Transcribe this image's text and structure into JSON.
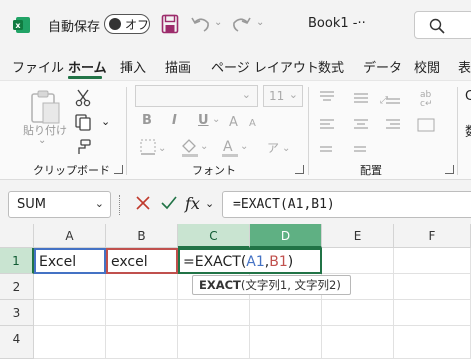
{
  "titlebar": {
    "autosave_label": "自動保存",
    "autosave_state": "オフ",
    "filename": "Book1  -··",
    "search_icon": "search-icon"
  },
  "menu": {
    "items": [
      "ファイル",
      "ホーム",
      "挿入",
      "描画",
      "ページ レイアウト",
      "数式",
      "データ",
      "校閲",
      "表"
    ],
    "active": "ホーム"
  },
  "ribbon": {
    "clipboard": {
      "paste_label": "貼り付け",
      "group_label": "クリップボード"
    },
    "font": {
      "size_value": "11",
      "bold": "B",
      "italic": "I",
      "underline": "U",
      "group_label": "フォント"
    },
    "alignment": {
      "group_label": "配置"
    },
    "overflow_label": "数",
    "overflow_top": "C"
  },
  "formula_bar": {
    "name_box": "SUM",
    "fx": "fx",
    "formula": "=EXACT(A1,B1)"
  },
  "grid": {
    "columns": [
      "A",
      "B",
      "C",
      "D",
      "E",
      "F"
    ],
    "selected_column": "C",
    "rows": [
      "1",
      "2",
      "3",
      "4"
    ],
    "selected_row": "1",
    "cells": {
      "A1": "Excel",
      "B1": "excel",
      "C1_prefix": "=EXACT(",
      "C1_ref1": "A1",
      "C1_comma": ",",
      "C1_ref2": "B1",
      "C1_suffix": ")"
    },
    "tooltip": {
      "func": "EXACT",
      "args": "(文字列1, 文字列2)"
    }
  },
  "colors": {
    "accent": "#217346",
    "ref_a": "#4472c4",
    "ref_b": "#c0504d",
    "selected_header_bg": "#c9e4d1"
  }
}
